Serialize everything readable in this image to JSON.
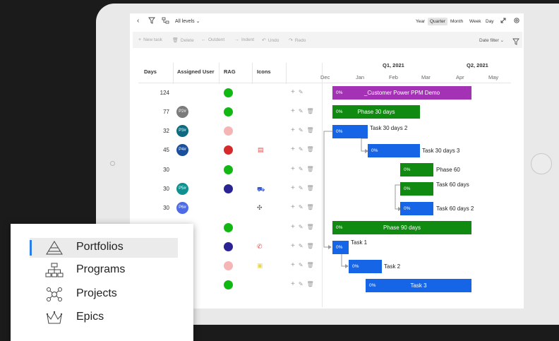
{
  "toolbar": {
    "levels_label": "All levels",
    "zoom_options": [
      "Year",
      "Quarter",
      "Month",
      "Week",
      "Day"
    ],
    "zoom_selected": "Quarter"
  },
  "commands": {
    "new_task": "New task",
    "delete": "Delete",
    "outdent": "Outdent",
    "indent": "Indent",
    "undo": "Undo",
    "redo": "Redo",
    "date_filter": "Date filter"
  },
  "columns": {
    "days": "Days",
    "assigned_user": "Assigned User",
    "rag": "RAG",
    "icons": "Icons"
  },
  "timeline": {
    "quarters": [
      "Q1, 2021",
      "Q2, 2021"
    ],
    "months": [
      "Dec",
      "Jan",
      "Feb",
      "Mar",
      "Apr",
      "May"
    ]
  },
  "rows": [
    {
      "days": "124",
      "avatar": "",
      "avatar_color": "",
      "rag_color": "#12b812",
      "icon": "",
      "can_delete": false
    },
    {
      "days": "77",
      "avatar": "P2#",
      "avatar_color": "#7b7b7b",
      "rag_color": "#12b812",
      "icon": "",
      "can_delete": true
    },
    {
      "days": "32",
      "avatar": "P3#",
      "avatar_color": "#0e6a7e",
      "rag_color": "#f5b5b5",
      "icon": "",
      "can_delete": true
    },
    {
      "days": "45",
      "avatar": "P4#",
      "avatar_color": "#1a4f9c",
      "rag_color": "#d62a2a",
      "icon": "clipboard-icon",
      "can_delete": true
    },
    {
      "days": "30",
      "avatar": "",
      "avatar_color": "",
      "rag_color": "#12b812",
      "icon": "",
      "can_delete": true
    },
    {
      "days": "30",
      "avatar": "P5#",
      "avatar_color": "#0f8f8f",
      "rag_color": "#2b2394",
      "icon": "car-icon",
      "can_delete": true
    },
    {
      "days": "30",
      "avatar": "P6#",
      "avatar_color": "#4c6be6",
      "rag_color": "",
      "icon": "org-chart-icon",
      "can_delete": true
    },
    {
      "days": "",
      "avatar": "",
      "avatar_color": "",
      "rag_color": "#12b812",
      "icon": "",
      "can_delete": true
    },
    {
      "days": "",
      "avatar": "",
      "avatar_color": "",
      "rag_color": "#2b2394",
      "icon": "phone-icon",
      "can_delete": true
    },
    {
      "days": "",
      "avatar": "",
      "avatar_color": "",
      "rag_color": "#f5b5b5",
      "icon": "note-icon",
      "can_delete": true
    },
    {
      "days": "",
      "avatar": "",
      "avatar_color": "",
      "rag_color": "#12b812",
      "icon": "",
      "can_delete": true
    }
  ],
  "bars": [
    {
      "pct": "0%",
      "name": "_Customer Power PPM Demo",
      "label_inside": true
    },
    {
      "pct": "0%",
      "name": "Phase 30 days",
      "label_inside": true
    },
    {
      "pct": "0%",
      "name": "Task 30 days 2",
      "label_inside": false
    },
    {
      "pct": "0%",
      "name": "Task 30 days 3",
      "label_inside": false
    },
    {
      "pct": "0%",
      "name": "Phase 60",
      "label_inside": false
    },
    {
      "pct": "0%",
      "name": "Task 60 days",
      "label_inside": false
    },
    {
      "pct": "0%",
      "name": "Task 60 days 2",
      "label_inside": false
    },
    {
      "pct": "0%",
      "name": "Phase 90 days",
      "label_inside": true
    },
    {
      "pct": "0%",
      "name": "Task 1",
      "label_inside": false
    },
    {
      "pct": "0%",
      "name": "Task 2",
      "label_inside": false
    },
    {
      "pct": "0%",
      "name": "Task 3",
      "label_inside": true
    }
  ],
  "levels_menu": {
    "items": [
      {
        "label": "Portfolios",
        "icon": "pyramid-icon",
        "active": true
      },
      {
        "label": "Programs",
        "icon": "hierarchy-icon",
        "active": false
      },
      {
        "label": "Projects",
        "icon": "network-icon",
        "active": false
      },
      {
        "label": "Epics",
        "icon": "crown-icon",
        "active": false
      }
    ]
  }
}
